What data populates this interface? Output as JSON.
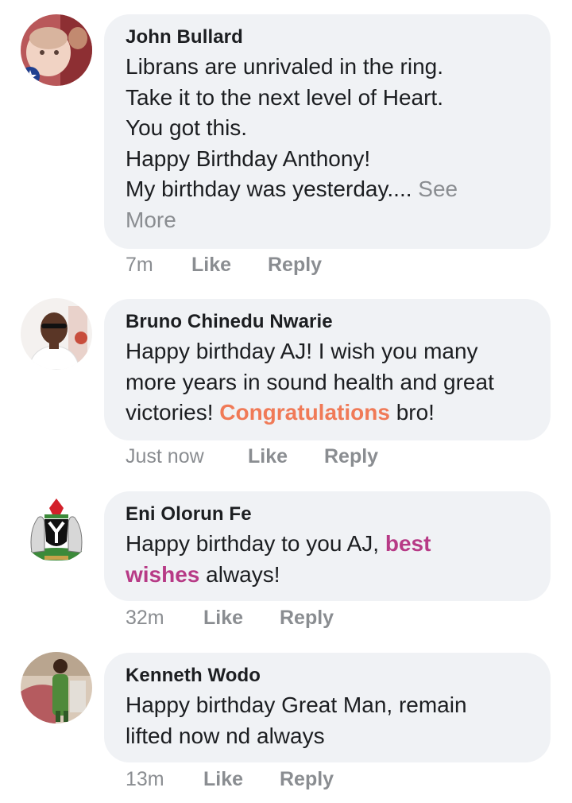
{
  "comments": [
    {
      "author": "John Bullard",
      "lines": [
        "Librans are unrivaled in the ring.",
        "Take it to the next level of Heart.",
        "You got this.",
        "Happy Birthday Anthony!",
        "My birthday was yesterday.... "
      ],
      "see_more_a": "See",
      "see_more_b": "More",
      "time": "7m",
      "like": "Like",
      "reply": "Reply"
    },
    {
      "author": "Bruno Chinedu Nwarie",
      "line1": "Happy birthday AJ! I wish you many",
      "line2": "more years in sound health and great",
      "line3_pre": "victories! ",
      "line3_hl": "Congratulations",
      "line3_post": " bro!",
      "time": "Just now",
      "like": "Like",
      "reply": "Reply"
    },
    {
      "author": "Eni Olorun Fe",
      "line1_pre": "Happy birthday to you AJ, ",
      "line1_hl": "best",
      "line2_hl": "wishes",
      "line2_post": " always!",
      "time": "32m",
      "like": "Like",
      "reply": "Reply"
    },
    {
      "author": "Kenneth Wodo",
      "line1": "Happy birthday Great Man, remain",
      "line2": "lifted now nd always",
      "time": "13m",
      "like": "Like",
      "reply": "Reply"
    }
  ],
  "colors": {
    "bubble": "#f0f2f5",
    "meta": "#8a8d91",
    "highlight_orange": "#f07a57",
    "highlight_pink": "#b73a86"
  }
}
